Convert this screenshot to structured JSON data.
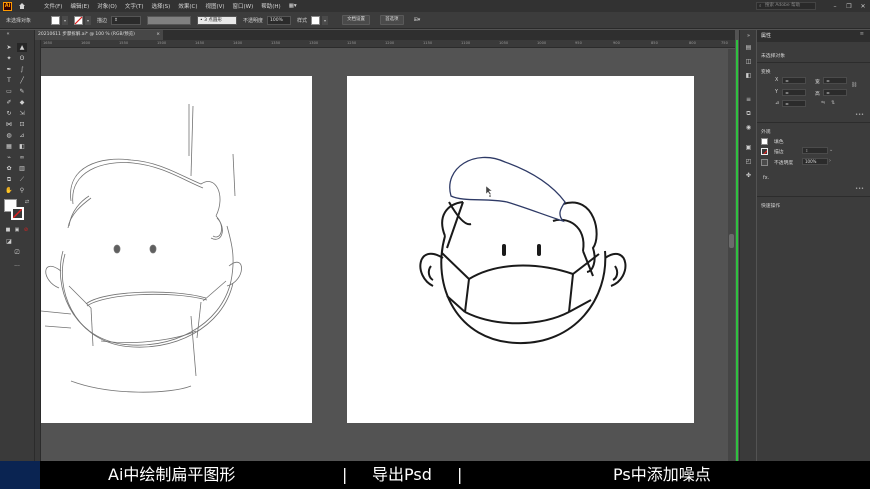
{
  "menubar": {
    "app_logo": "Ai",
    "items": [
      "文件(F)",
      "编辑(E)",
      "对象(O)",
      "文字(T)",
      "选择(S)",
      "效果(C)",
      "视图(V)",
      "窗口(W)",
      "帮助(H)"
    ],
    "search_placeholder": "搜索 Adobe 帮助"
  },
  "control_bar": {
    "selection_label": "未选择对象",
    "stroke_label": "描边",
    "brush_value": "3 点圆形",
    "opacity_label": "不透明度",
    "opacity_value": "100%",
    "style_label": "样式",
    "doc_setup_label": "文档设置",
    "prefs_label": "首选项"
  },
  "document_tab": {
    "title": "20210611 步骤拆解.ai* @ 100 % (RGB/预览)",
    "close": "×"
  },
  "ruler_ticks": [
    "1650",
    "1600",
    "1550",
    "1500",
    "1450",
    "1400",
    "1350",
    "1300",
    "1250",
    "1200",
    "1150",
    "1100",
    "1050",
    "1000",
    "950",
    "900",
    "850",
    "800",
    "750"
  ],
  "properties": {
    "tab_label": "属性",
    "no_selection": "未选择对象",
    "transform_label": "变换",
    "x_label": "X",
    "y_label": "Y",
    "w_label": "宽",
    "h_label": "高",
    "angle_label": "⊿",
    "appearance_label": "外观",
    "fill_label": "填色",
    "stroke_label": "描边",
    "opacity_label": "不透明度",
    "opacity_value": "100%",
    "fx_label": "fx.",
    "quick_actions_label": "快速操作"
  },
  "banner": {
    "step1": "Ai中绘制扁平图形",
    "sep1": "|",
    "step2": "导出Psd",
    "sep2": "|",
    "step3": "Ps中添加噪点"
  },
  "colors": {
    "accent_green": "#2fbf3f",
    "path_highlight": "#2e3a66",
    "app_logo_orange": "#ff9a00"
  }
}
